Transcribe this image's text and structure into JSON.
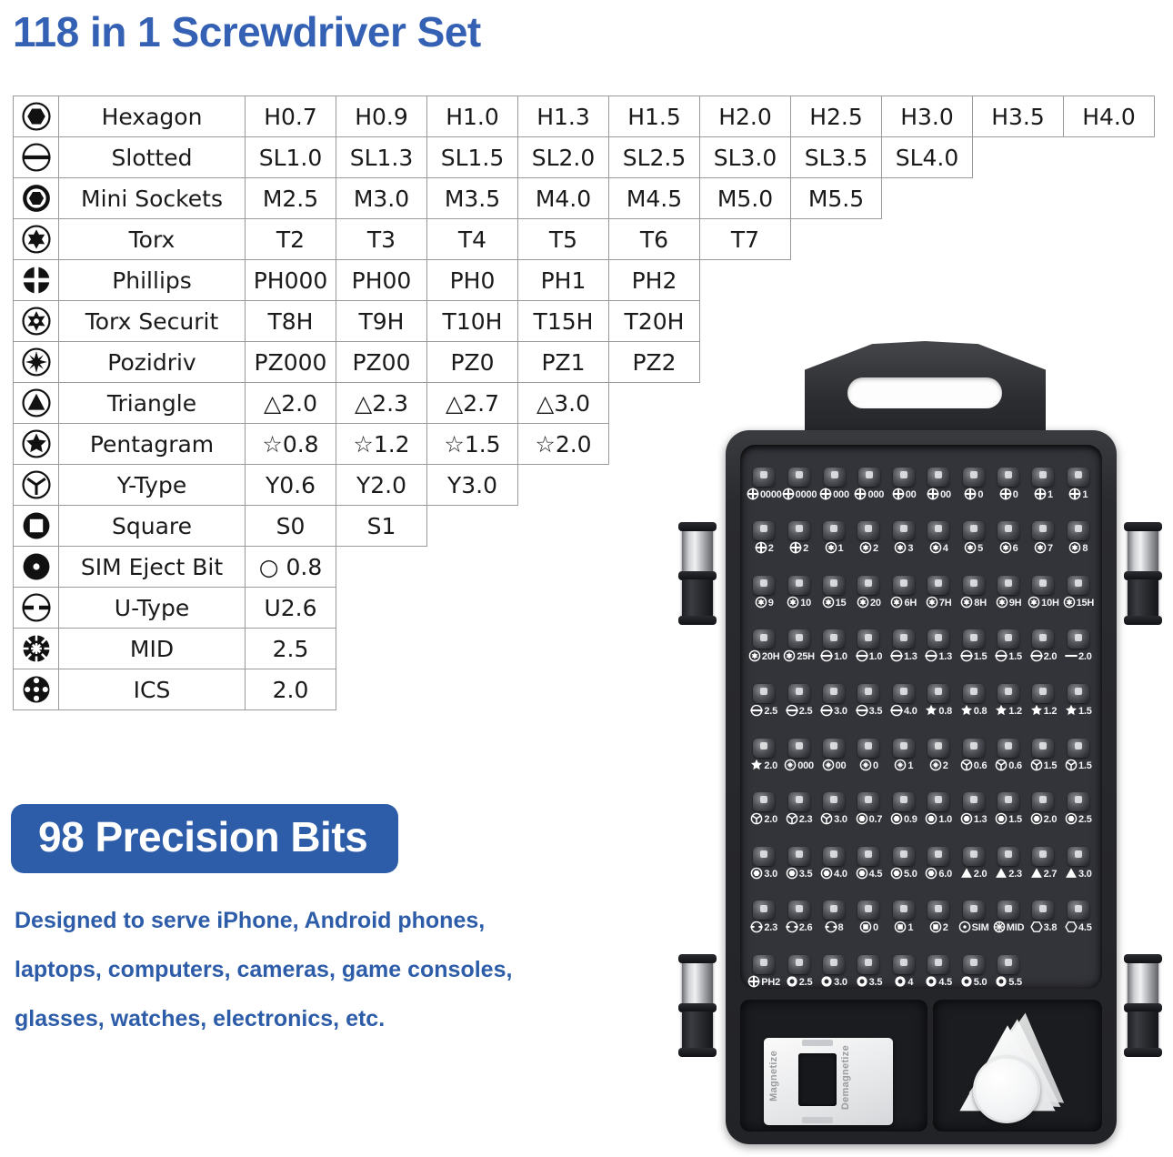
{
  "colors": {
    "title_blue": "#3461b4",
    "badge_blue": "#2d5ca8",
    "text_blue": "#2d5ca8",
    "table_border": "#9a9a9a",
    "case_black": "#2a2b2f"
  },
  "header": {
    "title": "118 in 1 Screwdriver Set"
  },
  "spec_table": {
    "max_columns": 10,
    "rows": [
      {
        "icon": "hexagon-bit-icon",
        "name": "Hexagon",
        "values": [
          "H0.7",
          "H0.9",
          "H1.0",
          "H1.3",
          "H1.5",
          "H2.0",
          "H2.5",
          "H3.0",
          "H3.5",
          "H4.0"
        ]
      },
      {
        "icon": "slotted-bit-icon",
        "name": "Slotted",
        "values": [
          "SL1.0",
          "SL1.3",
          "SL1.5",
          "SL2.0",
          "SL2.5",
          "SL3.0",
          "SL3.5",
          "SL4.0"
        ]
      },
      {
        "icon": "mini-socket-bit-icon",
        "name": "Mini Sockets",
        "values": [
          "M2.5",
          "M3.0",
          "M3.5",
          "M4.0",
          "M4.5",
          "M5.0",
          "M5.5"
        ]
      },
      {
        "icon": "torx-bit-icon",
        "name": "Torx",
        "values": [
          "T2",
          "T3",
          "T4",
          "T5",
          "T6",
          "T7"
        ]
      },
      {
        "icon": "phillips-bit-icon",
        "name": "Phillips",
        "values": [
          "PH000",
          "PH00",
          "PH0",
          "PH1",
          "PH2"
        ]
      },
      {
        "icon": "torx-securit-bit-icon",
        "name": "Torx Securit",
        "values": [
          "T8H",
          "T9H",
          "T10H",
          "T15H",
          "T20H"
        ]
      },
      {
        "icon": "pozidriv-bit-icon",
        "name": "Pozidriv",
        "values": [
          "PZ000",
          "PZ00",
          "PZ0",
          "PZ1",
          "PZ2"
        ]
      },
      {
        "icon": "triangle-bit-icon",
        "name": "Triangle",
        "values": [
          "△2.0",
          "△2.3",
          "△2.7",
          "△3.0"
        ]
      },
      {
        "icon": "pentagram-bit-icon",
        "name": "Pentagram",
        "values": [
          "☆0.8",
          "☆1.2",
          "☆1.5",
          "☆2.0"
        ]
      },
      {
        "icon": "y-type-bit-icon",
        "name": "Y-Type",
        "values": [
          "Y0.6",
          "Y2.0",
          "Y3.0"
        ]
      },
      {
        "icon": "square-bit-icon",
        "name": "Square",
        "values": [
          "S0",
          "S1"
        ]
      },
      {
        "icon": "sim-eject-bit-icon",
        "name": "SIM Eject Bit",
        "values": [
          "○ 0.8"
        ]
      },
      {
        "icon": "u-type-bit-icon",
        "name": "U-Type",
        "values": [
          "U2.6"
        ]
      },
      {
        "icon": "mid-bit-icon",
        "name": "MID",
        "values": [
          "2.5"
        ]
      },
      {
        "icon": "ics-bit-icon",
        "name": "ICS",
        "values": [
          "2.0"
        ]
      }
    ]
  },
  "badge": {
    "label": "98 Precision Bits"
  },
  "description": {
    "lines": [
      "Designed to serve iPhone, Android phones,",
      "laptops, computers, cameras, game consoles,",
      "glasses, watches, electronics, etc."
    ]
  },
  "product": {
    "case_bit_rows": [
      {
        "glyphs": [
          "phillips",
          "phillips",
          "phillips",
          "phillips",
          "phillips",
          "phillips",
          "phillips",
          "phillips",
          "phillips",
          "phillips"
        ],
        "labels": [
          "0000",
          "0000",
          "000",
          "000",
          "00",
          "00",
          "0",
          "0",
          "1",
          "1"
        ]
      },
      {
        "glyphs": [
          "phillips",
          "phillips",
          "torx",
          "torx",
          "torx",
          "torx",
          "torx",
          "torx",
          "torx",
          "torx"
        ],
        "labels": [
          "2",
          "2",
          "1",
          "2",
          "3",
          "4",
          "5",
          "6",
          "7",
          "8"
        ]
      },
      {
        "glyphs": [
          "torx",
          "torx",
          "torx",
          "torx",
          "torx",
          "torx",
          "torx",
          "torx",
          "torx",
          "torx"
        ],
        "labels": [
          "9",
          "10",
          "15",
          "20",
          "6H",
          "7H",
          "8H",
          "9H",
          "10H",
          "15H"
        ]
      },
      {
        "glyphs": [
          "torx",
          "torx",
          "slotted",
          "slotted",
          "slotted",
          "slotted",
          "slotted",
          "slotted",
          "slotted",
          "flat"
        ],
        "labels": [
          "20H",
          "25H",
          "1.0",
          "1.0",
          "1.3",
          "1.3",
          "1.5",
          "1.5",
          "2.0",
          "2.0"
        ]
      },
      {
        "glyphs": [
          "slotted",
          "slotted",
          "slotted",
          "slotted",
          "slotted",
          "star",
          "star",
          "star",
          "star",
          "star"
        ],
        "labels": [
          "2.5",
          "2.5",
          "3.0",
          "3.5",
          "4.0",
          "0.8",
          "0.8",
          "1.2",
          "1.2",
          "1.5"
        ]
      },
      {
        "glyphs": [
          "star",
          "pozidriv",
          "pozidriv",
          "pozidriv",
          "pozidriv",
          "pozidriv",
          "ytype",
          "ytype",
          "ytype",
          "ytype"
        ],
        "labels": [
          "2.0",
          "000",
          "00",
          "0",
          "1",
          "2",
          "0.6",
          "0.6",
          "1.5",
          "1.5"
        ]
      },
      {
        "glyphs": [
          "ytype",
          "ytype",
          "ytype",
          "hex",
          "hex",
          "hex",
          "hex",
          "hex",
          "hex",
          "hex"
        ],
        "labels": [
          "2.0",
          "2.3",
          "3.0",
          "0.7",
          "0.9",
          "1.0",
          "1.3",
          "1.5",
          "2.0",
          "2.5"
        ]
      },
      {
        "glyphs": [
          "hex",
          "hex",
          "hex",
          "hex",
          "hex",
          "hex",
          "triangle",
          "triangle",
          "triangle",
          "triangle"
        ],
        "labels": [
          "3.0",
          "3.5",
          "4.0",
          "4.5",
          "5.0",
          "6.0",
          "2.0",
          "2.3",
          "2.7",
          "3.0"
        ]
      },
      {
        "glyphs": [
          "utype",
          "utype",
          "utype",
          "square",
          "square",
          "square",
          "sim",
          "mid",
          "hexsock",
          "hexsock"
        ],
        "labels": [
          "2.3",
          "2.6",
          "8",
          "0",
          "1",
          "2",
          "SIM",
          "MID",
          "3.8",
          "4.5"
        ]
      },
      {
        "glyphs": [
          "phillips",
          "socket",
          "socket",
          "socket",
          "socket",
          "socket",
          "socket",
          "socket"
        ],
        "labels": [
          "PH2",
          "2.5",
          "3.0",
          "3.5",
          "4",
          "4.5",
          "5.0",
          "5.5"
        ]
      }
    ],
    "magnetizer": {
      "magnetize_label": "Magnetize",
      "demagnetize_label": "Demagnetize"
    }
  }
}
